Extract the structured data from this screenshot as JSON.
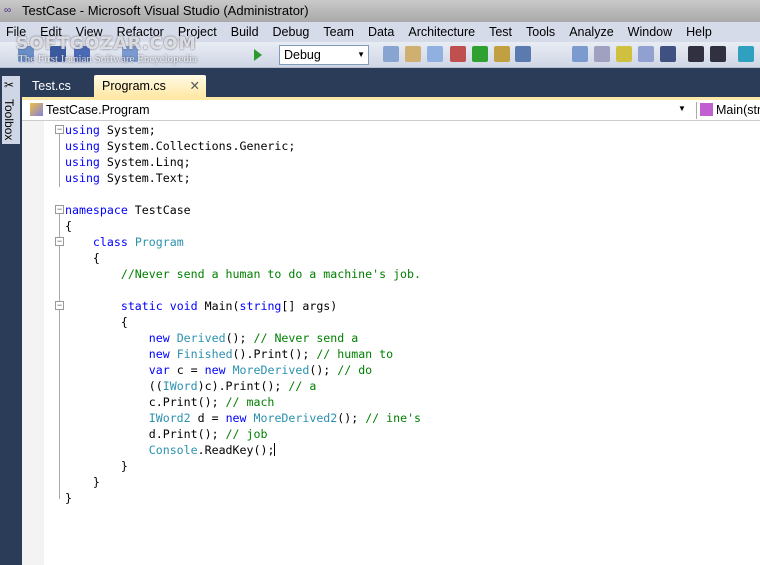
{
  "window": {
    "title": "TestCase - Microsoft Visual Studio (Administrator)",
    "logo_icon": "infinity-icon"
  },
  "menu": [
    "File",
    "Edit",
    "View",
    "Refactor",
    "Project",
    "Build",
    "Debug",
    "Team",
    "Data",
    "Architecture",
    "Test",
    "Tools",
    "Analyze",
    "Window",
    "Help"
  ],
  "toolbar": {
    "config": "Debug",
    "start_icon": "play-icon"
  },
  "watermark": {
    "line1": "SOFTGOZAR.COM",
    "line2": "The First Iranian Software Encyclopedia"
  },
  "toolbox": {
    "label": "Toolbox"
  },
  "tabs": [
    {
      "label": "Test.cs",
      "active": false
    },
    {
      "label": "Program.cs",
      "active": true,
      "close": "✕"
    }
  ],
  "navbar": {
    "type": "TestCase.Program",
    "member": "Main(str"
  },
  "colors": {
    "keyword": "#0000ff",
    "type": "#2b91af",
    "comment": "#008000",
    "tab_active": "#ffe8a6"
  },
  "code": [
    [
      [
        "using",
        "kw"
      ],
      [
        " System;",
        "pl"
      ]
    ],
    [
      [
        "using",
        "kw"
      ],
      [
        " System.Collections.Generic;",
        "pl"
      ]
    ],
    [
      [
        "using",
        "kw"
      ],
      [
        " System.Linq;",
        "pl"
      ]
    ],
    [
      [
        "using",
        "kw"
      ],
      [
        " System.Text;",
        "pl"
      ]
    ],
    [],
    [
      [
        "namespace",
        "kw"
      ],
      [
        " TestCase",
        "pl"
      ]
    ],
    [
      [
        "{",
        "pl"
      ]
    ],
    [
      [
        "    ",
        "pl"
      ],
      [
        "class",
        "kw"
      ],
      [
        " ",
        "pl"
      ],
      [
        "Program",
        "ty"
      ]
    ],
    [
      [
        "    {",
        "pl"
      ]
    ],
    [
      [
        "        ",
        "pl"
      ],
      [
        "//Never send a human to do a machine's job.",
        "cm"
      ]
    ],
    [],
    [
      [
        "        ",
        "pl"
      ],
      [
        "static",
        "kw"
      ],
      [
        " ",
        "pl"
      ],
      [
        "void",
        "kw"
      ],
      [
        " Main(",
        "pl"
      ],
      [
        "string",
        "kw"
      ],
      [
        "[] args)",
        "pl"
      ]
    ],
    [
      [
        "        {",
        "pl"
      ]
    ],
    [
      [
        "            ",
        "pl"
      ],
      [
        "new",
        "kw"
      ],
      [
        " ",
        "pl"
      ],
      [
        "Derived",
        "ty"
      ],
      [
        "(); ",
        "pl"
      ],
      [
        "// Never send a",
        "cm"
      ]
    ],
    [
      [
        "            ",
        "pl"
      ],
      [
        "new",
        "kw"
      ],
      [
        " ",
        "pl"
      ],
      [
        "Finished",
        "ty"
      ],
      [
        "().Print(); ",
        "pl"
      ],
      [
        "// human to",
        "cm"
      ]
    ],
    [
      [
        "            ",
        "pl"
      ],
      [
        "var",
        "kw"
      ],
      [
        " c = ",
        "pl"
      ],
      [
        "new",
        "kw"
      ],
      [
        " ",
        "pl"
      ],
      [
        "MoreDerived",
        "ty"
      ],
      [
        "(); ",
        "pl"
      ],
      [
        "// do",
        "cm"
      ]
    ],
    [
      [
        "            ((",
        "pl"
      ],
      [
        "IWord",
        "ty"
      ],
      [
        ")c).Print(); ",
        "pl"
      ],
      [
        "// a",
        "cm"
      ]
    ],
    [
      [
        "            c.Print(); ",
        "pl"
      ],
      [
        "// mach",
        "cm"
      ]
    ],
    [
      [
        "            ",
        "pl"
      ],
      [
        "IWord2",
        "ty"
      ],
      [
        " d = ",
        "pl"
      ],
      [
        "new",
        "kw"
      ],
      [
        " ",
        "pl"
      ],
      [
        "MoreDerived2",
        "ty"
      ],
      [
        "(); ",
        "pl"
      ],
      [
        "// ine's",
        "cm"
      ]
    ],
    [
      [
        "            d.Print(); ",
        "pl"
      ],
      [
        "// job",
        "cm"
      ]
    ],
    [
      [
        "            ",
        "pl"
      ],
      [
        "Console",
        "ty"
      ],
      [
        ".ReadKey();",
        "pl"
      ]
    ],
    [
      [
        "        }",
        "pl"
      ]
    ],
    [
      [
        "    }",
        "pl"
      ]
    ],
    [
      [
        "}",
        "pl"
      ]
    ]
  ]
}
